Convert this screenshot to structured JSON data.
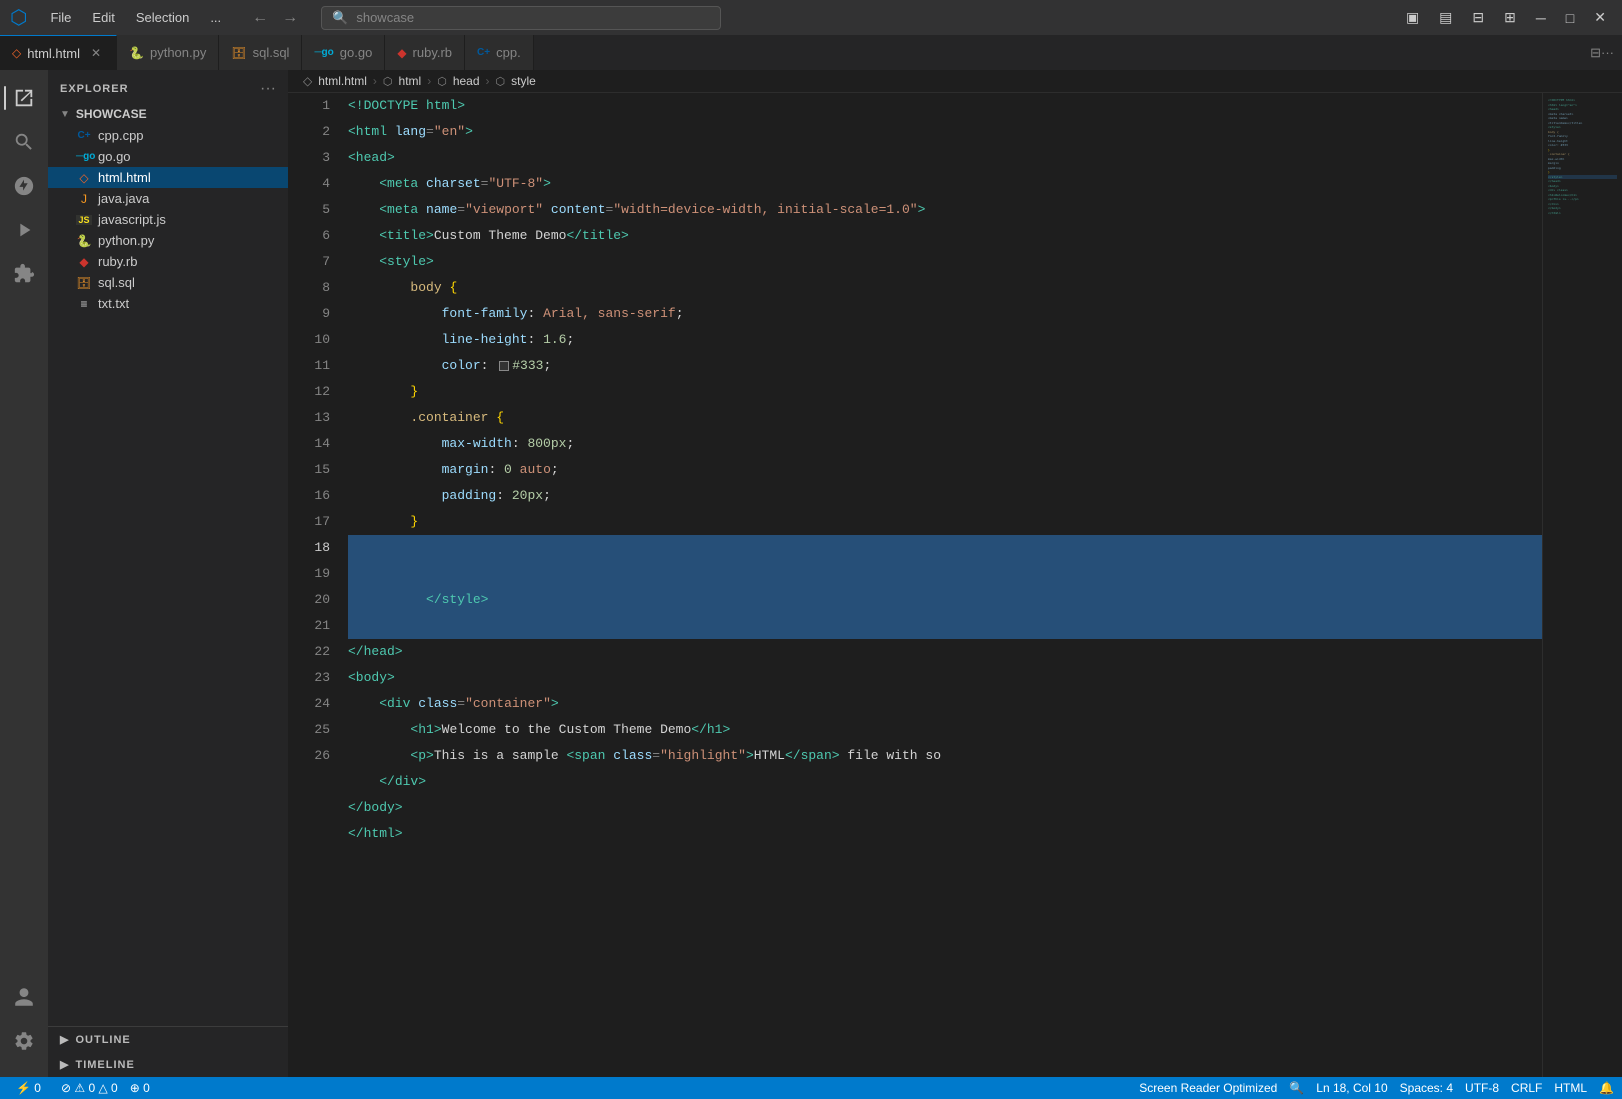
{
  "titleBar": {
    "logo": "⬡",
    "menuItems": [
      "File",
      "Edit",
      "Selection",
      "..."
    ],
    "searchPlaceholder": "showcase",
    "navBack": "←",
    "navForward": "→",
    "windowControls": [
      "⊟",
      "⧉",
      "✕"
    ]
  },
  "tabs": [
    {
      "id": "html",
      "icon": "◇",
      "iconColor": "#f16529",
      "label": "html.html",
      "active": true,
      "closeable": true
    },
    {
      "id": "python",
      "icon": "🐍",
      "iconColor": "#3776ab",
      "label": "python.py",
      "active": false,
      "closeable": false
    },
    {
      "id": "sql",
      "icon": "🗄",
      "iconColor": "#e48e28",
      "label": "sql.sql",
      "active": false,
      "closeable": false
    },
    {
      "id": "go",
      "icon": "go",
      "iconColor": "#00acd7",
      "label": "go.go",
      "active": false,
      "closeable": false
    },
    {
      "id": "ruby",
      "icon": "◆",
      "iconColor": "#cc342d",
      "label": "ruby.rb",
      "active": false,
      "closeable": false
    },
    {
      "id": "cpp",
      "icon": "C+",
      "iconColor": "#00599c",
      "label": "cpp.",
      "active": false,
      "closeable": false
    }
  ],
  "activityBar": {
    "items": [
      {
        "id": "explorer",
        "icon": "⎘",
        "active": true
      },
      {
        "id": "search",
        "icon": "🔍",
        "active": false
      },
      {
        "id": "git",
        "icon": "⌥",
        "active": false
      },
      {
        "id": "run",
        "icon": "▷",
        "active": false
      },
      {
        "id": "extensions",
        "icon": "⊞",
        "active": false
      }
    ],
    "bottomItems": [
      {
        "id": "account",
        "icon": "👤"
      },
      {
        "id": "settings",
        "icon": "⚙"
      }
    ]
  },
  "sidebar": {
    "title": "EXPLORER",
    "folder": "SHOWCASE",
    "files": [
      {
        "name": "cpp.cpp",
        "icon": "C+",
        "iconColor": "#00599c",
        "active": false
      },
      {
        "name": "go.go",
        "icon": "go",
        "iconColor": "#00acd7",
        "active": false
      },
      {
        "name": "html.html",
        "icon": "◇",
        "iconColor": "#f16529",
        "active": true
      },
      {
        "name": "java.java",
        "icon": "☕",
        "iconColor": "#f89820",
        "active": false
      },
      {
        "name": "javascript.js",
        "icon": "JS",
        "iconColor": "#f7df1e",
        "active": false
      },
      {
        "name": "python.py",
        "icon": "🐍",
        "iconColor": "#3776ab",
        "active": false
      },
      {
        "name": "ruby.rb",
        "icon": "◆",
        "iconColor": "#cc342d",
        "active": false
      },
      {
        "name": "sql.sql",
        "icon": "🗄",
        "iconColor": "#e48e28",
        "active": false
      },
      {
        "name": "txt.txt",
        "icon": "≡",
        "iconColor": "#cccccc",
        "active": false
      }
    ],
    "outline": "OUTLINE",
    "timeline": "TIMELINE"
  },
  "breadcrumb": {
    "items": [
      "html.html",
      "html",
      "head",
      "style"
    ]
  },
  "codeLines": [
    {
      "num": 1,
      "content": "<!DOCTYPE html>"
    },
    {
      "num": 2,
      "content": "<html lang=\"en\">"
    },
    {
      "num": 3,
      "content": "<head>"
    },
    {
      "num": 4,
      "content": "    <meta charset=\"UTF-8\">"
    },
    {
      "num": 5,
      "content": "    <meta name=\"viewport\" content=\"width=device-width, initial-scale=1.0\">"
    },
    {
      "num": 6,
      "content": "    <title>Custom Theme Demo</title>"
    },
    {
      "num": 7,
      "content": "    <style>"
    },
    {
      "num": 8,
      "content": "        body {"
    },
    {
      "num": 9,
      "content": "            font-family: Arial, sans-serif;"
    },
    {
      "num": 10,
      "content": "            line-height: 1.6;"
    },
    {
      "num": 11,
      "content": "            color:  #333;"
    },
    {
      "num": 12,
      "content": "        }"
    },
    {
      "num": 13,
      "content": "        .container {"
    },
    {
      "num": 14,
      "content": "            max-width: 800px;"
    },
    {
      "num": 15,
      "content": "            margin: 0 auto;"
    },
    {
      "num": 16,
      "content": "            padding: 20px;"
    },
    {
      "num": 17,
      "content": "        }"
    },
    {
      "num": 18,
      "content": "    </style>",
      "highlighted": true
    },
    {
      "num": 19,
      "content": "</head>"
    },
    {
      "num": 20,
      "content": "<body>"
    },
    {
      "num": 21,
      "content": "    <div class=\"container\">"
    },
    {
      "num": 22,
      "content": "        <h1>Welcome to the Custom Theme Demo</h1>"
    },
    {
      "num": 23,
      "content": "        <p>This is a sample <span class=\"highlight\">HTML</span> file with so"
    },
    {
      "num": 24,
      "content": "    </div>"
    },
    {
      "num": 25,
      "content": "</body>"
    },
    {
      "num": 26,
      "content": "</html>"
    }
  ],
  "statusBar": {
    "left": {
      "errors": "⚠ 0",
      "warnings": "△ 0",
      "network": "⊕ 0"
    },
    "screenReader": "Screen Reader Optimized",
    "right": {
      "position": "Ln 18, Col 10",
      "spaces": "Spaces: 4",
      "encoding": "UTF-8",
      "lineEnding": "CRLF",
      "language": "HTML",
      "zoom": "🔍",
      "bell": "🔔"
    }
  }
}
